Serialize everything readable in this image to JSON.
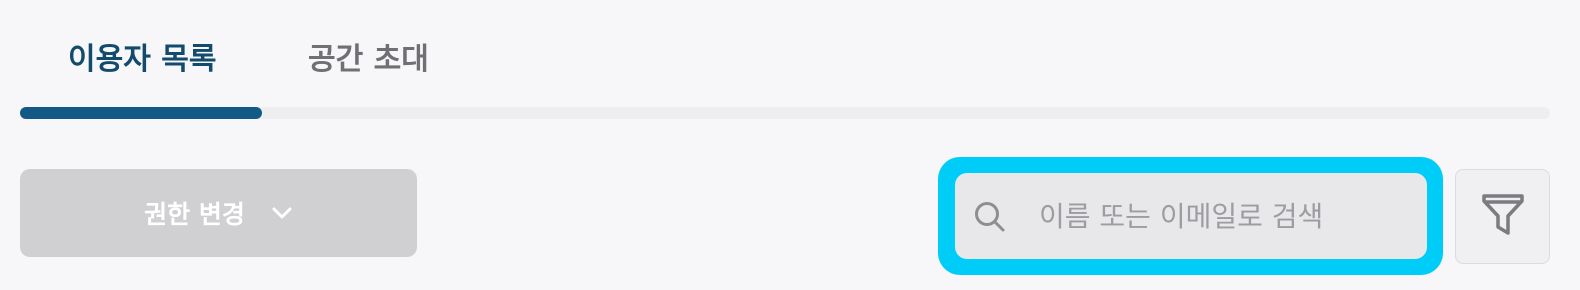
{
  "tabs": [
    {
      "label": "이용자 목록",
      "active": true
    },
    {
      "label": "공간 초대",
      "active": false
    }
  ],
  "toolbar": {
    "permission_button_label": "권한 변경",
    "permission_button_icon": "chevron-down-icon"
  },
  "search": {
    "placeholder": "이름 또는 이메일로 검색",
    "value": "",
    "icon": "search-icon",
    "focus_color": "#00ccf8"
  },
  "filter": {
    "icon": "filter-icon"
  },
  "colors": {
    "accent": "#125a85",
    "active_tab_text": "#134b6d",
    "inactive_tab_text": "#6f6f74",
    "disabled_button": "#d0cfd2"
  }
}
